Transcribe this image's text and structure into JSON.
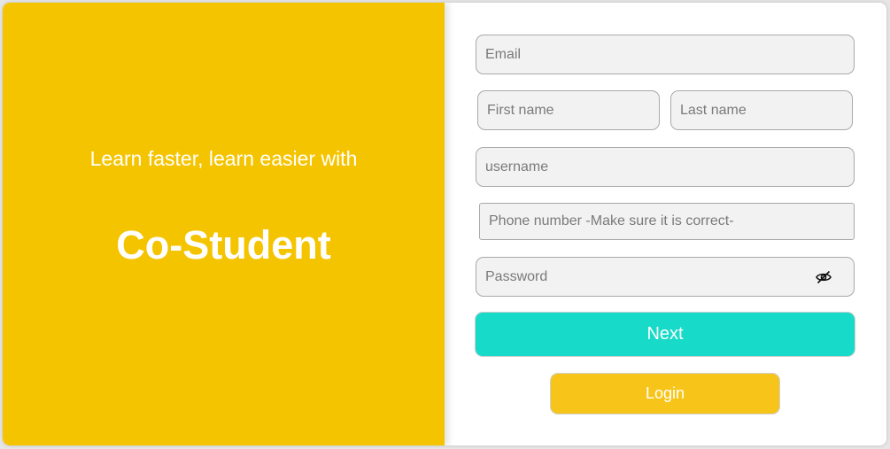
{
  "brand": {
    "tagline": "Learn faster, learn easier with",
    "name": "Co-Student"
  },
  "form": {
    "email_placeholder": "Email",
    "first_name_placeholder": "First name",
    "last_name_placeholder": "Last name",
    "username_placeholder": "username",
    "phone_placeholder": "Phone number -Make sure it is correct-",
    "password_placeholder": "Password",
    "password_toggle_icon": "eye-slash-icon",
    "next_label": "Next",
    "login_label": "Login"
  },
  "colors": {
    "brand_yellow": "#f5c400",
    "next_button": "#17dbc8",
    "login_button": "#f7c51a"
  }
}
